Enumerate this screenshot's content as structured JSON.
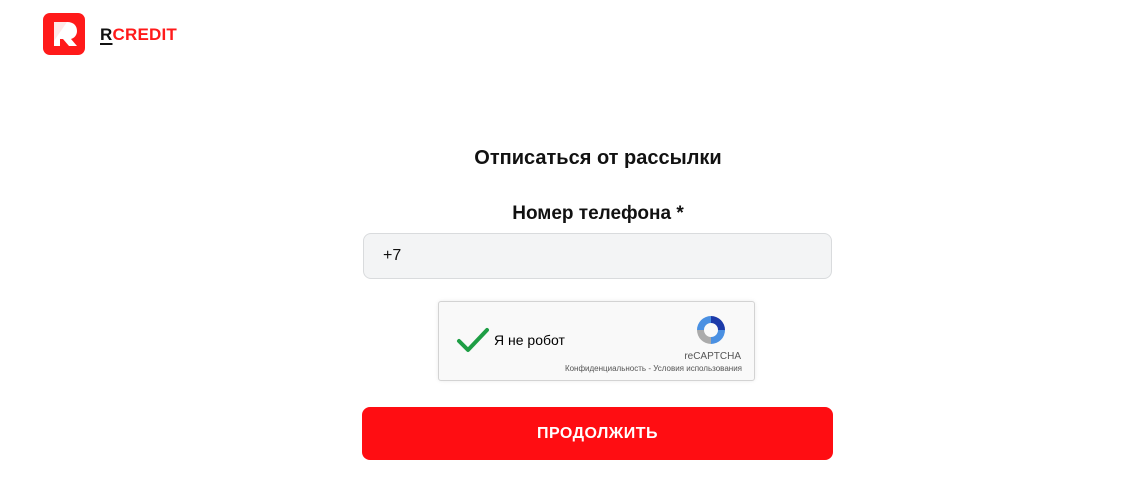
{
  "brand": {
    "letter": "R",
    "name": "CREDIT",
    "accent": "#ff1a1a"
  },
  "form": {
    "title": "Отписаться от рассылки",
    "phone_label": "Номер телефона *",
    "phone_value": "+7",
    "submit_label": "ПРОДОЛЖИТЬ",
    "button_color": "#ff0d12"
  },
  "captcha": {
    "label": "Я не робот",
    "checked": true,
    "brand": "reCAPTCHA",
    "privacy_link": "Конфиденциальность",
    "separator": " - ",
    "terms_link": "Условия использования"
  }
}
